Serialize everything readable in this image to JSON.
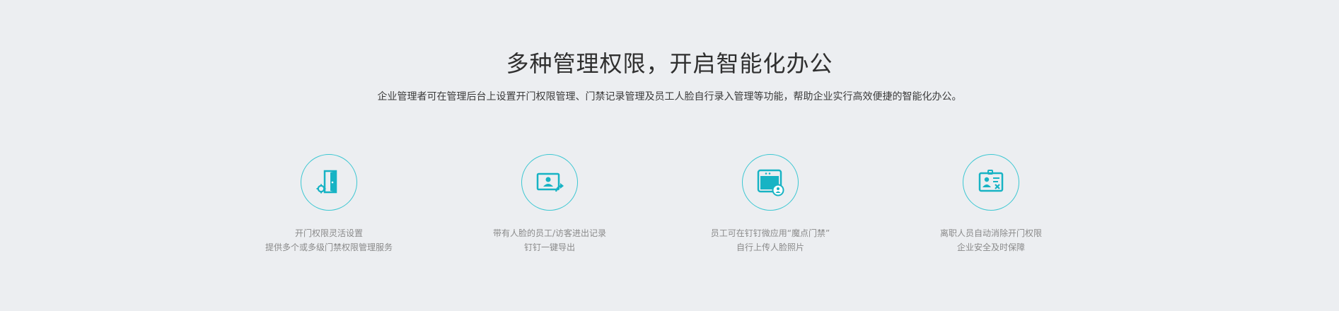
{
  "header": {
    "title": "多种管理权限，开启智能化办公",
    "subtitle": "企业管理者可在管理后台上设置开门权限管理、门禁记录管理及员工人脸自行录入管理等功能，帮助企业实行高效便捷的智能化办公。"
  },
  "accent_color": "#17b3c4",
  "features": [
    {
      "icon": "door-gear-icon",
      "line1": "开门权限灵活设置",
      "line2": "提供多个或多级门禁权限管理服务"
    },
    {
      "icon": "face-record-share-icon",
      "line1": "带有人脸的员工/访客进出记录",
      "line2": "钉钉一键导出"
    },
    {
      "icon": "app-user-upload-icon",
      "line1": "员工可在钉钉微应用“魔点门禁”",
      "line2": "自行上传人脸照片"
    },
    {
      "icon": "badge-remove-icon",
      "line1": "离职人员自动消除开门权限",
      "line2": "企业安全及时保障"
    }
  ]
}
